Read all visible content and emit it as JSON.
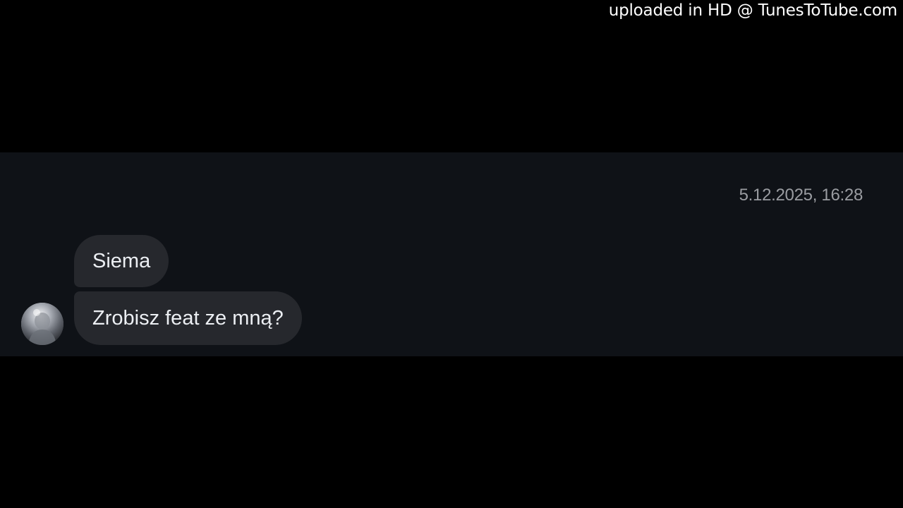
{
  "watermark": {
    "text": "uploaded in HD @ TunesToTube.com"
  },
  "chat": {
    "timestamp": "5.12.2025, 16:28",
    "messages": [
      {
        "text": "Siema"
      },
      {
        "text": "Zrobisz feat ze mną?"
      }
    ],
    "sender": {
      "avatar_icon": "user-avatar-photo"
    }
  },
  "colors": {
    "page_background": "#000000",
    "panel_background": "#0f1217",
    "bubble_background": "#26282d",
    "bubble_text": "#eceff3",
    "timestamp_text": "#9a9ca1",
    "watermark_text": "#ffffff"
  }
}
